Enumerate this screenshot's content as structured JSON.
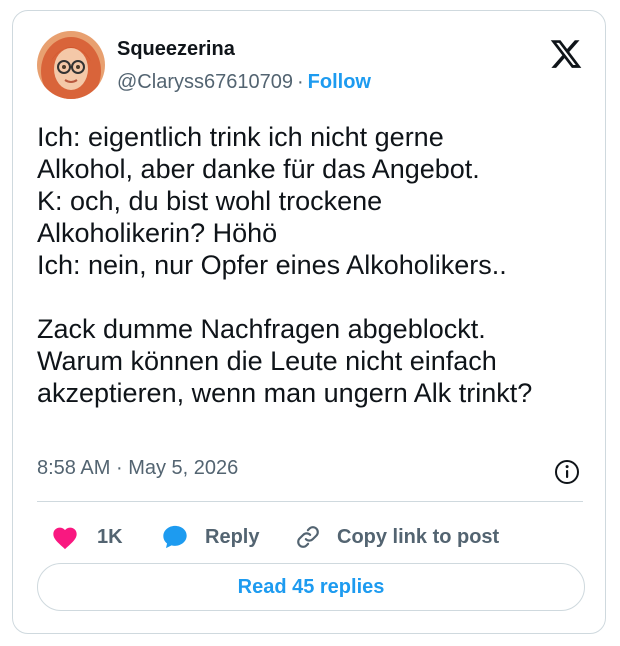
{
  "author": {
    "display_name": "Squeezerina",
    "handle": "@Claryss67610709",
    "separator": "·",
    "follow_label": "Follow"
  },
  "tweet": {
    "lines": [
      "Ich: eigentlich trink ich nicht gerne",
      "Alkohol, aber danke für das Angebot.",
      "K: och, du bist wohl trockene",
      "Alkoholikerin? Höhö",
      "Ich: nein, nur Opfer eines Alkoholikers..",
      "",
      "Zack dumme Nachfragen abgeblockt.",
      "Warum können die Leute nicht einfach",
      "akzeptieren, wenn man ungern Alk trinkt?"
    ],
    "time": "8:58 AM",
    "separator": "·",
    "date": "May 5, 2026"
  },
  "actions": {
    "like_count": "1K",
    "reply_label": "Reply",
    "copy_label": "Copy link to post"
  },
  "read_replies_label": "Read 45 replies",
  "colors": {
    "accent": "#1d9bf0",
    "like": "#f91880",
    "text": "#0f1419",
    "muted": "#536471",
    "border": "#cfd9de"
  },
  "icons": {
    "logo": "x-logo-icon",
    "info": "info-icon",
    "like": "heart-icon",
    "reply": "speech-bubble-icon",
    "copy": "link-icon"
  }
}
